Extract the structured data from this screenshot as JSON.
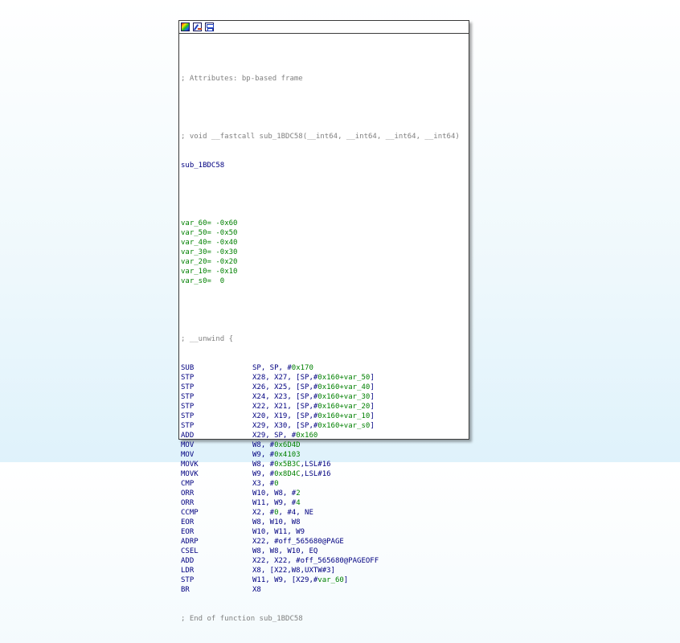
{
  "toolbar": {
    "icons": [
      "set-node-color-icon",
      "rename-node-icon",
      "group-nodes-icon"
    ]
  },
  "colors": {
    "comment": "#808080",
    "mnemonic": "#000080",
    "operand": "#000080",
    "stack_var": "#008000",
    "border": "#3a3a3a"
  },
  "code": {
    "attr_comment": "; Attributes: bp-based frame",
    "sig_comment": "; void __fastcall sub_1BDC58(__int64, __int64, __int64, __int64)",
    "func_name": "sub_1BDC58",
    "vars": [
      {
        "name": "var_60",
        "value": "= -0x60"
      },
      {
        "name": "var_50",
        "value": "= -0x50"
      },
      {
        "name": "var_40",
        "value": "= -0x40"
      },
      {
        "name": "var_30",
        "value": "= -0x30"
      },
      {
        "name": "var_20",
        "value": "= -0x20"
      },
      {
        "name": "var_10",
        "value": "= -0x10"
      },
      {
        "name": "var_s0",
        "value": "=  0"
      }
    ],
    "unwind_comment": "; __unwind {",
    "instructions": [
      {
        "mn": "SUB",
        "a": "SP, SP, #",
        "g": "0x170",
        "b": ""
      },
      {
        "mn": "STP",
        "a": "X28, X27, [SP,#",
        "g": "0x160+var_50",
        "b": "]"
      },
      {
        "mn": "STP",
        "a": "X26, X25, [SP,#",
        "g": "0x160+var_40",
        "b": "]"
      },
      {
        "mn": "STP",
        "a": "X24, X23, [SP,#",
        "g": "0x160+var_30",
        "b": "]"
      },
      {
        "mn": "STP",
        "a": "X22, X21, [SP,#",
        "g": "0x160+var_20",
        "b": "]"
      },
      {
        "mn": "STP",
        "a": "X20, X19, [SP,#",
        "g": "0x160+var_10",
        "b": "]"
      },
      {
        "mn": "STP",
        "a": "X29, X30, [SP,#",
        "g": "0x160+var_s0",
        "b": "]"
      },
      {
        "mn": "ADD",
        "a": "X29, SP, #",
        "g": "0x160",
        "b": ""
      },
      {
        "mn": "MOV",
        "a": "W8, #",
        "g": "0x6D4D",
        "b": ""
      },
      {
        "mn": "MOV",
        "a": "W9, #",
        "g": "0x4103",
        "b": ""
      },
      {
        "mn": "MOVK",
        "a": "W8, #",
        "g": "0x5B3C",
        "b": ",LSL#16"
      },
      {
        "mn": "MOVK",
        "a": "W9, #",
        "g": "0x8D4C",
        "b": ",LSL#16"
      },
      {
        "mn": "CMP",
        "a": "X3, #",
        "g": "0",
        "b": ""
      },
      {
        "mn": "ORR",
        "a": "W10, W8, #",
        "g": "2",
        "b": ""
      },
      {
        "mn": "ORR",
        "a": "W11, W9, #",
        "g": "4",
        "b": ""
      },
      {
        "mn": "CCMP",
        "a": "X2, #",
        "g": "0",
        "b": ", #4, NE"
      },
      {
        "mn": "EOR",
        "a": "W8, W10, W8",
        "g": "",
        "b": ""
      },
      {
        "mn": "EOR",
        "a": "W10, W11, W9",
        "g": "",
        "b": ""
      },
      {
        "mn": "ADRP",
        "a": "X22, #off_565680@PAGE",
        "g": "",
        "b": ""
      },
      {
        "mn": "CSEL",
        "a": "W8, W8, W10, EQ",
        "g": "",
        "b": ""
      },
      {
        "mn": "ADD",
        "a": "X22, X22, #off_565680@PAGEOFF",
        "g": "",
        "b": ""
      },
      {
        "mn": "LDR",
        "a": "X8, [X22,W8,UXTW#3]",
        "g": "",
        "b": ""
      },
      {
        "mn": "STP",
        "a": "W11, W9, [X29,#",
        "g": "var_60",
        "b": "]"
      },
      {
        "mn": "BR",
        "a": "X8",
        "g": "",
        "b": ""
      }
    ],
    "end_comment": "; End of function sub_1BDC58"
  }
}
